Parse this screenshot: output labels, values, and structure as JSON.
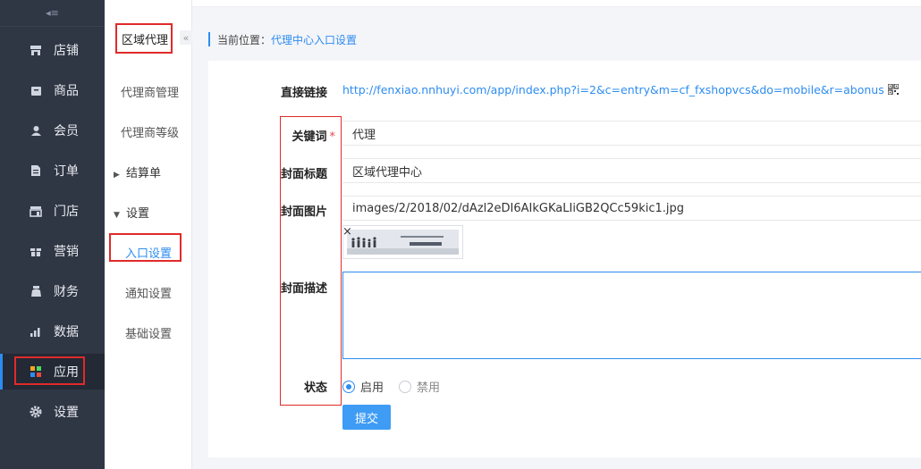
{
  "sidebar": {
    "items": [
      {
        "label": "店铺",
        "icon": "store-icon"
      },
      {
        "label": "商品",
        "icon": "goods-icon"
      },
      {
        "label": "会员",
        "icon": "user-icon"
      },
      {
        "label": "订单",
        "icon": "order-icon"
      },
      {
        "label": "门店",
        "icon": "shop-icon"
      },
      {
        "label": "营销",
        "icon": "gift-icon"
      },
      {
        "label": "财务",
        "icon": "money-bag-icon"
      },
      {
        "label": "数据",
        "icon": "chart-icon"
      },
      {
        "label": "应用",
        "icon": "apps-icon"
      },
      {
        "label": "设置",
        "icon": "gear-icon"
      }
    ],
    "active_label": "应用"
  },
  "subnav": {
    "title": "区域代理",
    "collapse_glyph": "«",
    "items": [
      {
        "label": "代理商管理"
      },
      {
        "label": "代理商等级"
      },
      {
        "label": "结算单"
      },
      {
        "label": "设置"
      },
      {
        "label": "入口设置"
      },
      {
        "label": "通知设置"
      },
      {
        "label": "基础设置"
      }
    ]
  },
  "breadcrumb": {
    "prefix": "当前位置：",
    "current": "代理中心入口设置"
  },
  "form": {
    "link_label": "直接链接",
    "link_value": "http://fenxiao.nnhuyi.com/app/index.php?i=2&c=entry&m=cf_fxshopvcs&do=mobile&r=abonus",
    "keyword_label": "关键词",
    "required_mark": "*",
    "keyword_value": "代理",
    "title_label": "封面标题",
    "title_value": "区域代理中心",
    "image_label": "封面图片",
    "image_value": "images/2/2018/02/dAzl2eDI6AIkGKaLIiGB2QCc59kic1.jpg",
    "image_remove": "×",
    "desc_label": "封面描述",
    "desc_value": "",
    "status_label": "状态",
    "status_options": [
      "启用",
      "禁用"
    ],
    "status_selected": "启用",
    "submit_label": "提交"
  },
  "colors": {
    "accent": "#2d8cf0",
    "sidebar_bg": "#2f3644",
    "highlight": "#e02a2a"
  }
}
